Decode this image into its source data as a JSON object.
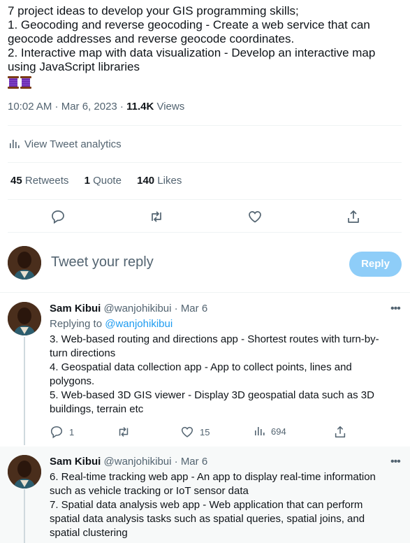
{
  "tweet": {
    "lines": [
      "7 project ideas to develop your GIS programming skills;",
      "1. Geocoding and reverse geocoding - Create a web service that can",
      "geocode addresses and reverse geocode coordinates.",
      "2. Interactive map with data visualization - Develop an interactive map",
      "using JavaScript libraries"
    ],
    "emoji": [
      "thread-spool-icon",
      "thread-spool-icon"
    ],
    "time": "10:02 AM · Mar 6, 2023 · ",
    "views_count": "11.4K",
    "views_label": " Views"
  },
  "analytics_label": "View Tweet analytics",
  "stats": {
    "retweets_count": "45",
    "retweets_label": " Retweets",
    "quotes_count": "1",
    "quotes_label": " Quote",
    "likes_count": "140",
    "likes_label": " Likes"
  },
  "compose": {
    "placeholder": "Tweet your reply",
    "button": "Reply"
  },
  "replies": [
    {
      "name": "Sam Kibui",
      "handle": "@wanjohikibui",
      "date": " · Mar 6",
      "replying_prefix": "Replying to ",
      "replying_handle": "@wanjohikibui",
      "lines": [
        "3. Web-based routing and directions app - Shortest routes with turn-by-",
        "turn directions",
        "4. Geospatial data collection app - App to collect points, lines and",
        "polygons.",
        "5. Web-based 3D GIS viewer - Display 3D geospatial data such as 3D",
        "buildings, terrain etc"
      ],
      "reply_count": "1",
      "retweet_count": "",
      "like_count": "15",
      "views_count": "694"
    },
    {
      "name": "Sam Kibui",
      "handle": "@wanjohikibui",
      "date": " · Mar 6",
      "lines": [
        "6. Real-time tracking web app - An app to display real-time information",
        "such as vehicle tracking or IoT sensor data",
        "7. Spatial data analysis web app - Web application that can perform",
        "spatial data analysis tasks such as spatial queries, spatial joins, and",
        "spatial clustering"
      ]
    }
  ],
  "colors": {
    "accent": "#1d9bf0",
    "reply_button": "#8ecdf8",
    "muted": "#536471"
  }
}
